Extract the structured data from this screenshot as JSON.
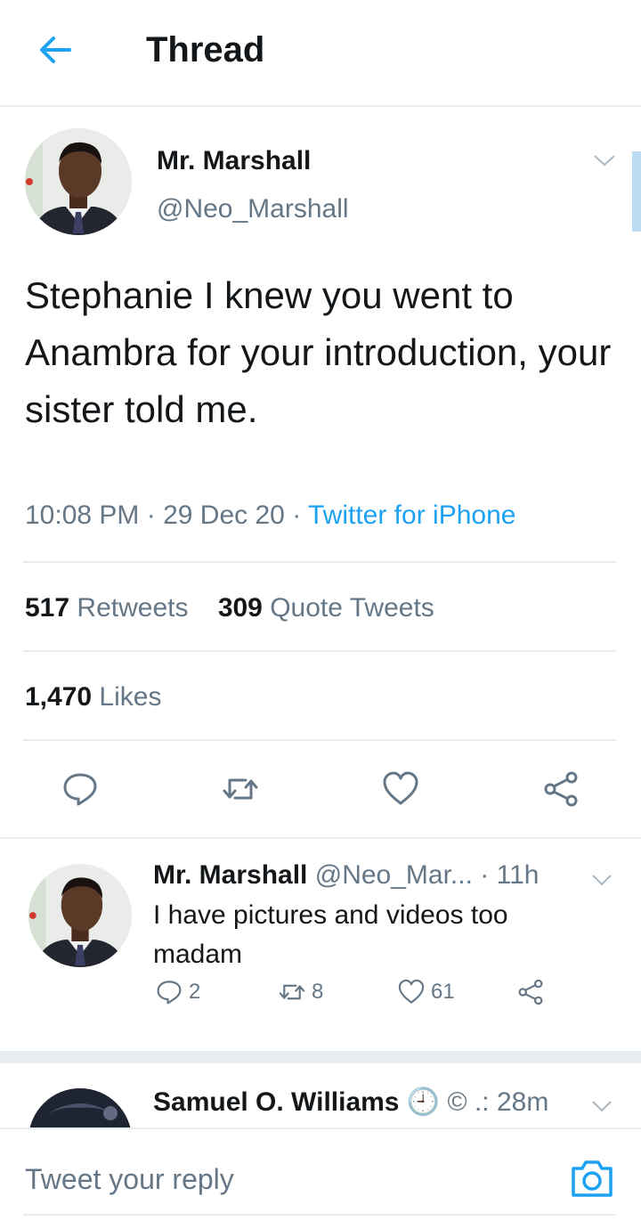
{
  "header": {
    "title": "Thread",
    "back_icon": "arrow-left-icon",
    "accent": "#1da1f2"
  },
  "main_tweet": {
    "name": "Mr. Marshall",
    "handle": "@Neo_Marshall",
    "text": "Stephanie I knew you went to Anambra for your introduction, your sister told me.",
    "time": "10:08 PM",
    "date": "29 Dec 20",
    "source": "Twitter for iPhone",
    "retweets_count": "517",
    "retweets_label": "Retweets",
    "quotes_count": "309",
    "quotes_label": "Quote Tweets",
    "likes_count": "1,470",
    "likes_label": "Likes",
    "actions": [
      "reply-icon",
      "retweet-icon",
      "like-icon",
      "share-icon"
    ]
  },
  "replies": [
    {
      "name": "Mr. Marshall",
      "handle": "@Neo_Mar...",
      "time": "· 11h",
      "text": "I have pictures and videos too madam",
      "reply_count": "2",
      "retweet_count": "8",
      "like_count": "61"
    },
    {
      "name": "Samuel O. Williams",
      "handle": "🕘 © .:",
      "time": "28m"
    }
  ],
  "reply_bar": {
    "placeholder": "Tweet your reply",
    "camera_icon": "camera-icon"
  }
}
